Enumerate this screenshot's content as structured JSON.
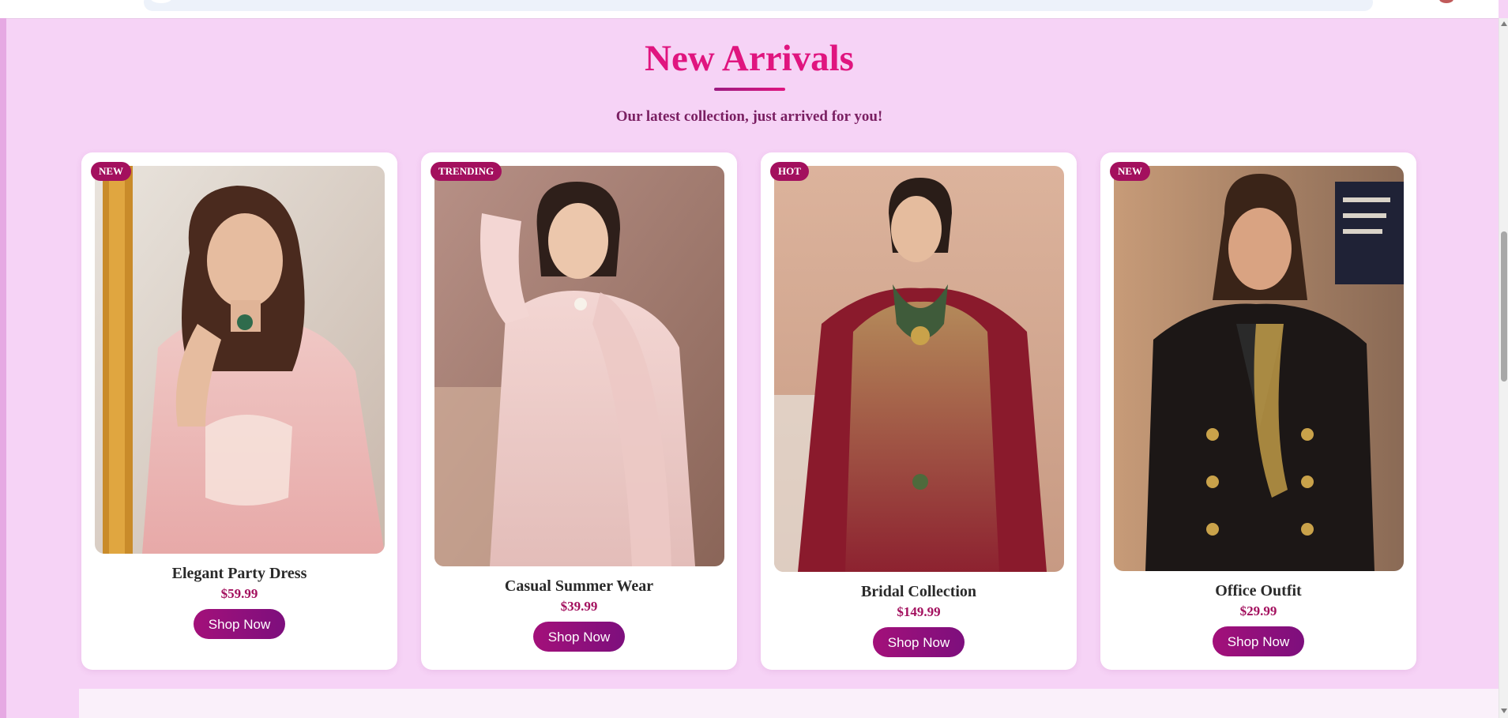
{
  "section": {
    "title": "New Arrivals",
    "subtitle": "Our latest collection, just arrived for you!"
  },
  "colors": {
    "accent": "#e0157f",
    "badge": "#a3105e",
    "button": "#8a0f7c",
    "background": "#f6d3f6"
  },
  "products": [
    {
      "badge": "NEW",
      "name": "Elegant Party Dress",
      "price": "$59.99",
      "button_label": "Shop Now",
      "image_alt": "Woman in pink embroidered outfit adjusting earring"
    },
    {
      "badge": "TRENDING",
      "name": "Casual Summer Wear",
      "price": "$39.99",
      "button_label": "Shop Now",
      "image_alt": "Woman in blush embroidered outfit with dupatta"
    },
    {
      "badge": "HOT",
      "name": "Bridal Collection",
      "price": "$149.99",
      "button_label": "Shop Now",
      "image_alt": "Bride in maroon and gold embroidered outfit"
    },
    {
      "badge": "NEW",
      "name": "Office Outfit",
      "price": "$29.99",
      "button_label": "Shop Now",
      "image_alt": "Woman in black double-breasted blazer"
    }
  ]
}
